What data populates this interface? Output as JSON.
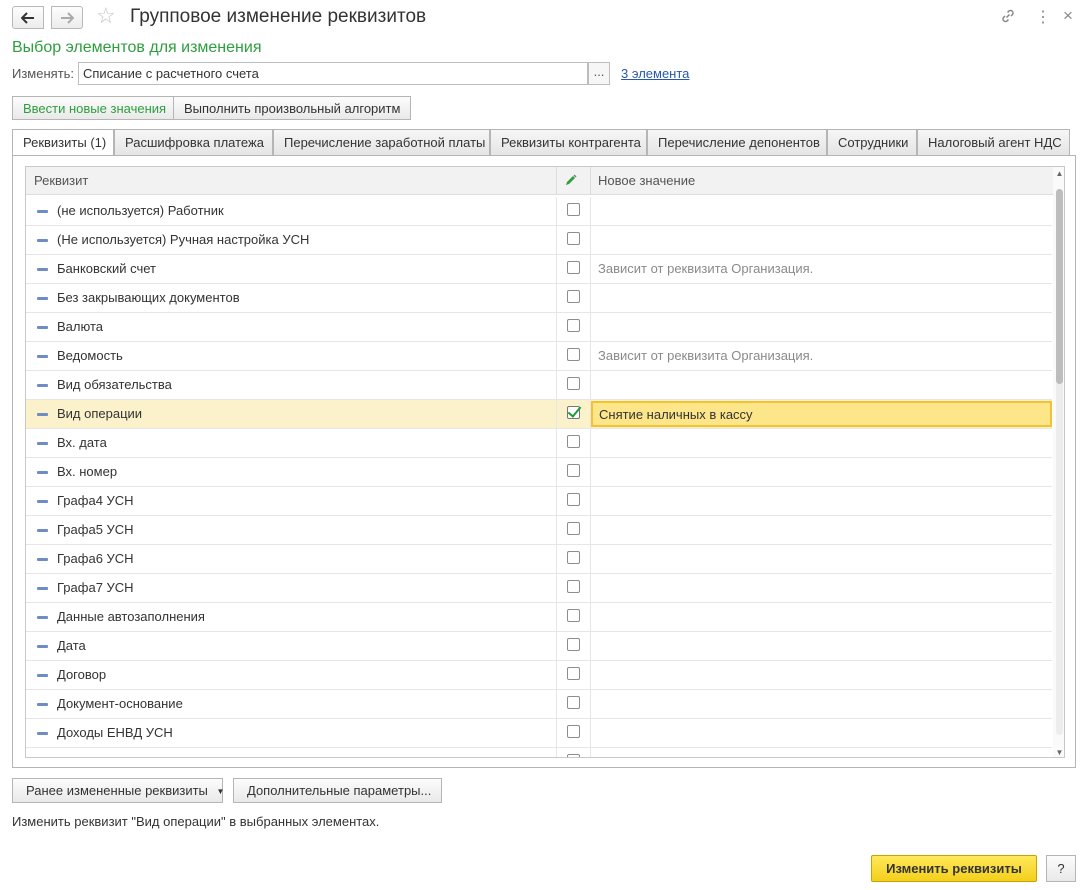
{
  "window": {
    "title": "Групповое изменение реквизитов",
    "back_icon": "arrow-left-icon",
    "forward_icon": "arrow-right-icon",
    "favorite_icon": "star-icon",
    "link_icon": "link-icon",
    "more_icon": "more-vertical-icon",
    "close_icon": "close-icon"
  },
  "header": {
    "subtitle": "Выбор элементов для изменения",
    "change_label": "Изменять:",
    "change_value": "Списание с расчетного счета",
    "select_button": "...",
    "count_link": "3 элемента"
  },
  "mode_buttons": {
    "new_values": "Ввести новые значения",
    "algorithm": "Выполнить произвольный алгоритм"
  },
  "tabs": [
    {
      "label": "Реквизиты (1)",
      "active": true
    },
    {
      "label": "Расшифровка платежа",
      "active": false
    },
    {
      "label": "Перечисление заработной платы",
      "active": false
    },
    {
      "label": "Реквизиты контрагента",
      "active": false
    },
    {
      "label": "Перечисление депонентов",
      "active": false
    },
    {
      "label": "Сотрудники",
      "active": false
    },
    {
      "label": "Налоговый агент НДС",
      "active": false
    }
  ],
  "grid": {
    "col_attribute": "Реквизит",
    "col_edit_icon": "pencil-icon",
    "col_new_value": "Новое значение",
    "rows": [
      {
        "name": "(не используется) Работник",
        "checked": false,
        "value": ""
      },
      {
        "name": "(Не используется) Ручная настройка УСН",
        "checked": false,
        "value": ""
      },
      {
        "name": "Банковский счет",
        "checked": false,
        "value": "Зависит от реквизита Организация."
      },
      {
        "name": "Без закрывающих документов",
        "checked": false,
        "value": ""
      },
      {
        "name": "Валюта",
        "checked": false,
        "value": ""
      },
      {
        "name": "Ведомость",
        "checked": false,
        "value": "Зависит от реквизита Организация."
      },
      {
        "name": "Вид обязательства",
        "checked": false,
        "value": ""
      },
      {
        "name": "Вид операции",
        "checked": true,
        "value": "Снятие наличных в кассу",
        "selected": true
      },
      {
        "name": "Вх. дата",
        "checked": false,
        "value": ""
      },
      {
        "name": "Вх. номер",
        "checked": false,
        "value": ""
      },
      {
        "name": "Графа4 УСН",
        "checked": false,
        "value": ""
      },
      {
        "name": "Графа5 УСН",
        "checked": false,
        "value": ""
      },
      {
        "name": "Графа6 УСН",
        "checked": false,
        "value": ""
      },
      {
        "name": "Графа7 УСН",
        "checked": false,
        "value": ""
      },
      {
        "name": "Данные автозаполнения",
        "checked": false,
        "value": ""
      },
      {
        "name": "Дата",
        "checked": false,
        "value": ""
      },
      {
        "name": "Договор",
        "checked": false,
        "value": ""
      },
      {
        "name": "Документ-основание",
        "checked": false,
        "value": ""
      },
      {
        "name": "Доходы ЕНВД УСН",
        "checked": false,
        "value": ""
      },
      {
        "name": "",
        "checked": false,
        "value": ""
      }
    ]
  },
  "footer": {
    "previous_button": "Ранее измененные реквизиты",
    "dropdown_icon": "chevron-down-icon",
    "additional_button": "Дополнительные параметры...",
    "status_text": "Изменить реквизит \"Вид операции\" в выбранных элементах.",
    "submit_button": "Изменить реквизиты",
    "help_button": "?"
  }
}
